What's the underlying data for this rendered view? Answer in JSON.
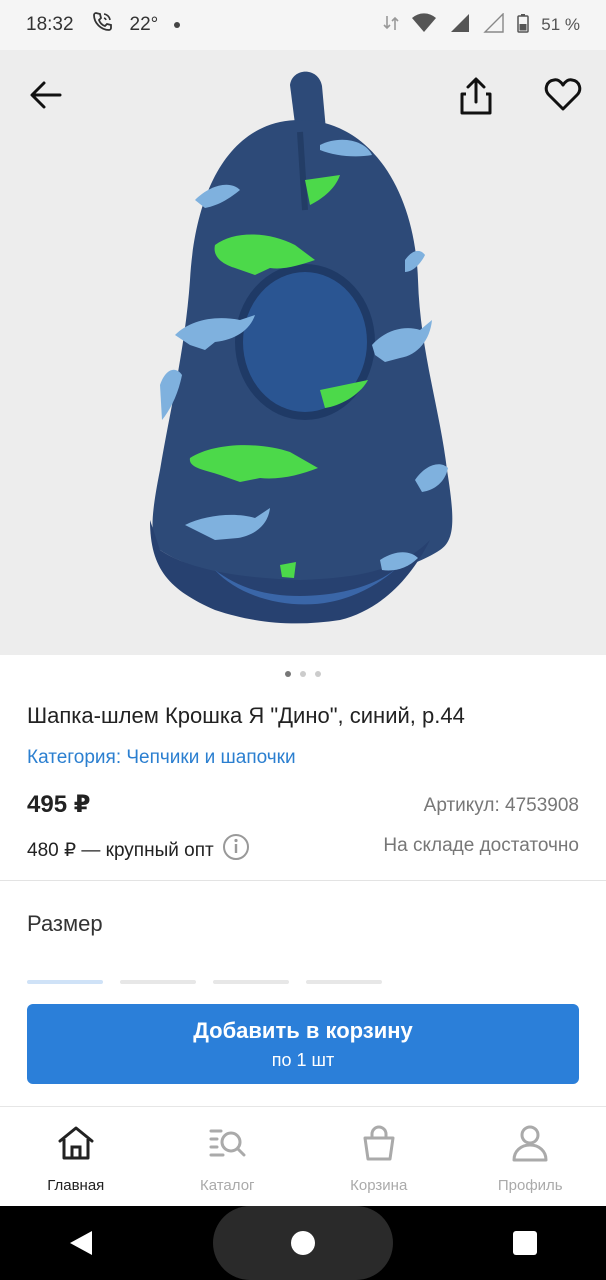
{
  "status": {
    "time": "18:32",
    "temperature": "22°",
    "battery": "51 %"
  },
  "product": {
    "title": "Шапка-шлем Крошка Я \"Дино\", синий, р.44",
    "category": "Категория: Чепчики и шапочки",
    "price": "495 ₽",
    "sku": "Артикул: 4753908",
    "wholesale": "480 ₽ — крупный опт",
    "stock": "На складе достаточно",
    "image_count": 3,
    "active_image": 1
  },
  "size_section": {
    "title": "Размер"
  },
  "cart_button": {
    "label": "Добавить в корзину",
    "quantity": "по 1 шт"
  },
  "tabs": [
    {
      "label": "Главная",
      "icon": "home-icon",
      "active": true
    },
    {
      "label": "Каталог",
      "icon": "catalog-search-icon",
      "active": false
    },
    {
      "label": "Корзина",
      "icon": "cart-bag-icon",
      "active": false
    },
    {
      "label": "Профиль",
      "icon": "profile-icon",
      "active": false
    }
  ],
  "colors": {
    "accent": "#2b7fd9",
    "link": "#2b7fd0",
    "hat_navy": "#2d4a78",
    "dino_green": "#4cd94a",
    "dino_blue": "#7fb1de"
  }
}
